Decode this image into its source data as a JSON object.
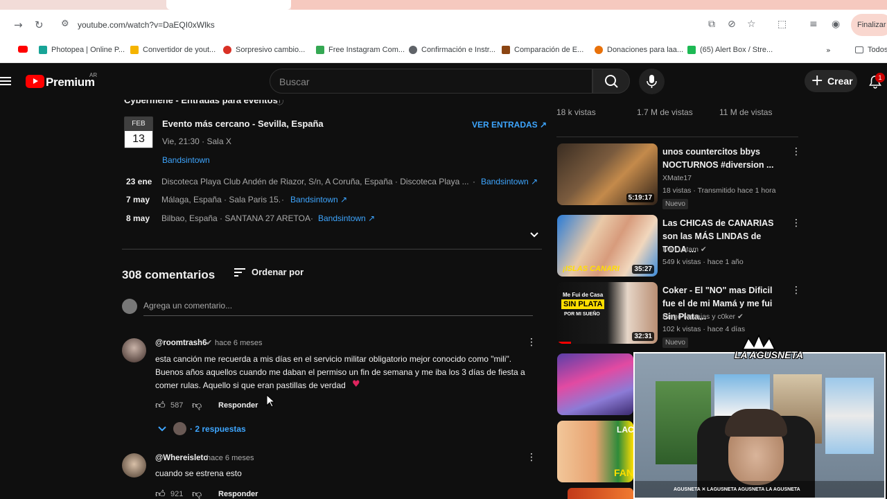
{
  "browser": {
    "url": "youtube.com/watch?v=DaEQI0xWlks",
    "finalize_label": "Finalizar a",
    "bookmarks": [
      {
        "label": "",
        "color": "#ff0000"
      },
      {
        "label": "Photopea | Online P...",
        "color": "#18a497"
      },
      {
        "label": "Convertidor de yout...",
        "color": "#f5b400"
      },
      {
        "label": "Sorpresivo cambio...",
        "color": "#d93025"
      },
      {
        "label": "Free Instagram Com...",
        "color": "#34a853"
      },
      {
        "label": "Confirmación e Instr...",
        "color": "#5f6368"
      },
      {
        "label": "Comparación de E...",
        "color": "#8b4513"
      },
      {
        "label": "Donaciones para laa...",
        "color": "#e8710a"
      },
      {
        "label": "(65) Alert Box / Stre...",
        "color": "#1db954"
      },
      {
        "label": "Todos",
        "color": "#5f6368"
      }
    ]
  },
  "header": {
    "logo_text": "Premium",
    "logo_region": "AR",
    "search_placeholder": "Buscar",
    "create_label": "Crear",
    "notification_count": "1"
  },
  "events": {
    "title": "Cybermene - Entradas para eventos",
    "nearest_month": "FEB",
    "nearest_day": "13",
    "nearest_title": "Evento más cercano - Sevilla, España",
    "nearest_sub": "Vie, 21:30 · Sala X",
    "nearest_source": "Bandsintown",
    "tickets_label": "VER ENTRADAS",
    "list": [
      {
        "date": "23 ene",
        "place": "Discoteca Playa Club Andén de Riazor, S/n, A Coruña, España · Discoteca Playa ...",
        "source": "Bandsintown"
      },
      {
        "date": "7 may",
        "place": "Málaga, España · Sala Paris 15.",
        "source": "Bandsintown"
      },
      {
        "date": "8 may",
        "place": "Bilbao, España · SANTANA 27 ARETOA",
        "source": "Bandsintown"
      }
    ]
  },
  "comments": {
    "count_label": "308 comentarios",
    "sort_label": "Ordenar por",
    "add_placeholder": "Agrega un comentario...",
    "items": [
      {
        "author": "@roomtrash6",
        "time": "hace 6 meses",
        "line1": "esta canción me recuerda a mis días en el servicio militar obligatorio mejor conocido como \"mili\".",
        "line2": "Buenos años aquellos cuando me daban el permiso un fin de semana y me iba los 3 días de fiesta a",
        "line3": "comer rulas. Aquello si que eran pastillas de verdad",
        "likes": "587",
        "reply_label": "Responder",
        "replies_label": "2 respuestas"
      },
      {
        "author": "@Whereisleto",
        "time": "hace 6 meses",
        "line1": "cuando se estrena esto",
        "likes": "921",
        "reply_label": "Responder"
      }
    ]
  },
  "recommendations": {
    "top_views": [
      "18 k vistas",
      "1.7 M de vistas",
      "11 M de vistas"
    ],
    "items": [
      {
        "title": "unos countercitos bbys NOCTURNOS #diversion ...",
        "channel": "XMate17",
        "meta": "18 vistas · Transmitido hace 1 hora",
        "badge": "Nuevo",
        "duration": "5:19:17"
      },
      {
        "title": "Las CHICAS de CANARIAS son las MÁS LINDAS de TODA ...",
        "channel": "Iván Latam",
        "meta": "549 k vistas · hace 1 año",
        "duration": "35:27"
      },
      {
        "title": "Coker - El \"NO\" mas Dificil fue el de mi Mamá y me fui Sin Plata...",
        "channel": "Diego Navajas y c0ker",
        "meta": "102 k vistas · hace 4 días",
        "badge": "Nuevo",
        "duration": "32:31"
      }
    ]
  },
  "overlay": {
    "watermark": "LA AGUSNETA",
    "social_strip": "AGUSNETA  ✕ LAGUSNETA  AGUSNETA  LA AGUSNETA"
  }
}
